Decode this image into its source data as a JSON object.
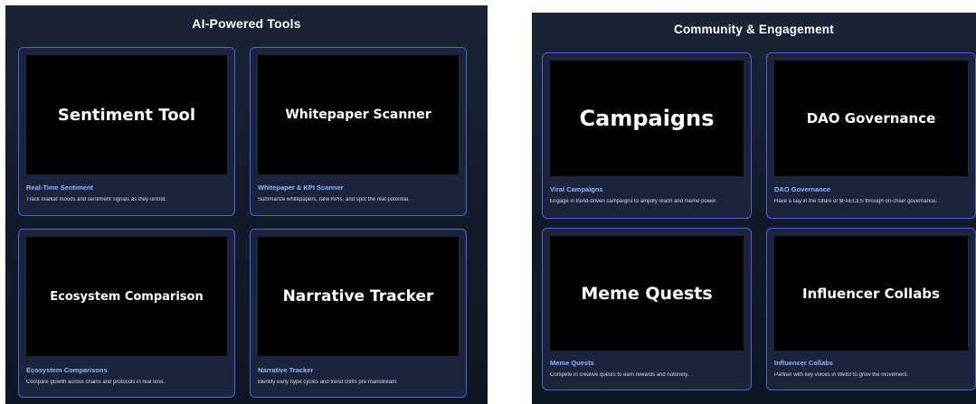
{
  "ai_tools": {
    "title": "AI-Powered Tools",
    "cards": [
      {
        "media_label": "Sentiment Tool",
        "title": "Real-Time Sentiment",
        "description": "Track market moods and sentiment signals as they unfold."
      },
      {
        "media_label": "Whitepaper Scanner",
        "title": "Whitepaper & KPI Scanner",
        "description": "Summarize whitepapers, rank KPIs, and spot the real potential."
      },
      {
        "media_label": "Ecosystem Comparison",
        "title": "Ecosystem Comparisons",
        "description": "Compare growth across chains and protocols in real time."
      },
      {
        "media_label": "Narrative Tracker",
        "title": "Narrative Tracker",
        "description": "Identify early hype cycles and trend shifts pre mainstream."
      }
    ]
  },
  "community": {
    "title": "Community & Engagement",
    "cards": [
      {
        "media_label": "Campaigns",
        "title": "Viral Campaigns",
        "description": "Engage in trend-driven campaigns to amplify reach and meme power."
      },
      {
        "media_label": "DAO Governance",
        "title": "DAO Governance",
        "description": "Have a say in the future of $FAECES through on-chain governance."
      },
      {
        "media_label": "Meme Quests",
        "title": "Meme Quests",
        "description": "Compete in creative quests to earn rewards and notoriety."
      },
      {
        "media_label": "Influencer Collabs",
        "title": "Influencer Collabs",
        "description": "Partner with key voices in Web3 to grow the movement."
      }
    ]
  },
  "colors": {
    "card_border": "#4a63d6",
    "card_title": "#8fb6ff",
    "panel_bg": "#141c2b"
  }
}
